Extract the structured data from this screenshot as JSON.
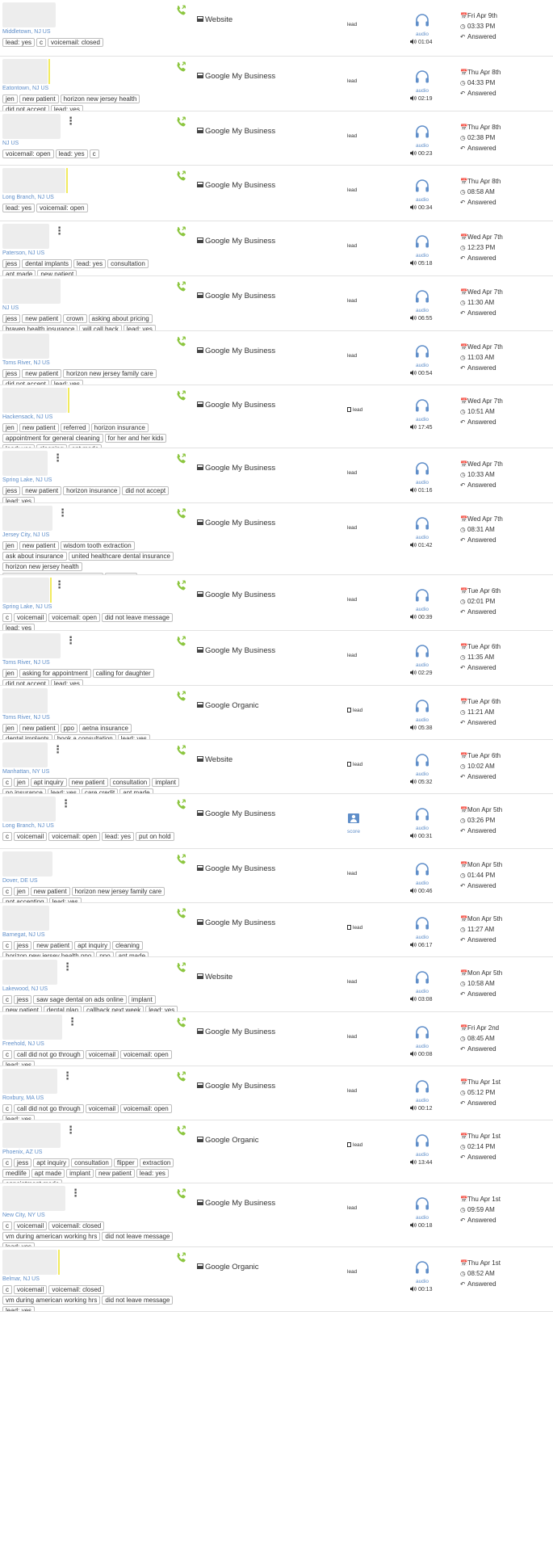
{
  "colors": {
    "accent": "#5f8ec9",
    "phone": "#8cc63f",
    "highlight": "#f1ea5e",
    "tag_border": "#bdbdbd"
  },
  "icons": {
    "phone": "phone-icon",
    "source": "source-icon",
    "headphones": "headphones-icon",
    "speaker": "speaker-icon",
    "calendar": "calendar-icon",
    "clock": "clock-icon",
    "answered": "answered-icon",
    "score": "user-score-icon",
    "kebab": "kebab-icon"
  },
  "calls": [
    {
      "location": "Middletown, NJ US",
      "tags": [
        "lead: yes",
        "c",
        "voicemail: closed"
      ],
      "source": "Website",
      "status": "lead",
      "audio_label": "audio",
      "duration": "01:04",
      "date": "Fri Apr 9th",
      "time": "03:33 PM",
      "result": "Answered",
      "bw": 66,
      "kebab": false,
      "yellow": false
    },
    {
      "location": "Eatontown, NJ US",
      "tags": [
        "jen",
        "new patient",
        "horizon new jersey health",
        "did not accept",
        "lead: yes"
      ],
      "source": "Google My Business",
      "status": "lead",
      "audio_label": "audio",
      "duration": "02:19",
      "date": "Thu Apr 8th",
      "time": "04:33 PM",
      "result": "Answered",
      "bw": 56,
      "kebab": false,
      "yellow": true
    },
    {
      "location": "NJ US",
      "tags": [
        "voicemail: open",
        "lead: yes",
        "c"
      ],
      "source": "Google My Business",
      "status": "lead",
      "audio_label": "audio",
      "duration": "00:23",
      "date": "Thu Apr 8th",
      "time": "02:38 PM",
      "result": "Answered",
      "bw": 72,
      "kebab": true,
      "yellow": false
    },
    {
      "location": "Long Branch, NJ US",
      "tags": [
        "lead: yes",
        "voicemail: open"
      ],
      "source": "Google My Business",
      "status": "lead",
      "audio_label": "audio",
      "duration": "00:34",
      "date": "Thu Apr 8th",
      "time": "08:58 AM",
      "result": "Answered",
      "bw": 78,
      "kebab": false,
      "yellow": true
    },
    {
      "location": "Paterson, NJ US",
      "tags": [
        "jess",
        "dental implants",
        "lead: yes",
        "consultation",
        "apt made",
        "new patient"
      ],
      "source": "Google My Business",
      "status": "lead",
      "audio_label": "audio",
      "duration": "05:18",
      "date": "Wed Apr 7th",
      "time": "12:23 PM",
      "result": "Answered",
      "bw": 58,
      "kebab": true,
      "yellow": false
    },
    {
      "location": "NJ US",
      "tags": [
        "jess",
        "new patient",
        "crown",
        "asking about pricing",
        "braven health insurance",
        "will call back",
        "lead: yes"
      ],
      "source": "Google My Business",
      "status": "lead",
      "audio_label": "audio",
      "duration": "06:55",
      "date": "Wed Apr 7th",
      "time": "11:30 AM",
      "result": "Answered",
      "bw": 72,
      "kebab": false,
      "yellow": false
    },
    {
      "location": "Toms River, NJ US",
      "tags": [
        "jess",
        "new patient",
        "horizon new jersey family care",
        "did not accept",
        "lead: yes"
      ],
      "source": "Google My Business",
      "status": "lead",
      "audio_label": "audio",
      "duration": "00:54",
      "date": "Wed Apr 7th",
      "time": "11:03 AM",
      "result": "Answered",
      "bw": 58,
      "kebab": false,
      "yellow": false
    },
    {
      "location": "Hackensack, NJ US",
      "tags": [
        "jen",
        "new patient",
        "referred",
        "horizon insurance",
        "appointment for general cleaning",
        "for her and her kids",
        "lead: yes",
        "cleaning",
        "apt made"
      ],
      "source": "Google My Business",
      "status": "lead",
      "doc": true,
      "audio_label": "audio",
      "duration": "17:45",
      "date": "Wed Apr 7th",
      "time": "10:51 AM",
      "result": "Answered",
      "bw": 80,
      "kebab": false,
      "yellow": true
    },
    {
      "location": "Spring Lake, NJ US",
      "tags": [
        "jess",
        "new patient",
        "horizon insurance",
        "did not accept",
        "lead: yes"
      ],
      "source": "Google My Business",
      "status": "lead",
      "audio_label": "audio",
      "duration": "01:16",
      "date": "Wed Apr 7th",
      "time": "10:33 AM",
      "result": "Answered",
      "bw": 56,
      "kebab": true,
      "yellow": false
    },
    {
      "location": "Jersey City, NJ US",
      "tags": [
        "jen",
        "new patient",
        "wisdom tooth extraction",
        "ask about insurance",
        "united healthcare dental insurance",
        "horizon new jersey health",
        "being referred to an oral surgeon",
        "lead: yes"
      ],
      "source": "Google My Business",
      "status": "lead",
      "audio_label": "audio",
      "duration": "01:42",
      "date": "Wed Apr 7th",
      "time": "08:31 AM",
      "result": "Answered",
      "bw": 62,
      "kebab": true,
      "yellow": false
    },
    {
      "location": "Spring Lake, NJ US",
      "tags": [
        "c",
        "voicemail",
        "voicemail: open",
        "did not leave message",
        "lead: yes"
      ],
      "source": "Google My Business",
      "status": "lead",
      "audio_label": "audio",
      "duration": "00:39",
      "date": "Tue Apr 6th",
      "time": "02:01 PM",
      "result": "Answered",
      "bw": 58,
      "kebab": true,
      "yellow": true
    },
    {
      "location": "Toms River, NJ US",
      "tags": [
        "jen",
        "asking for appointment",
        "calling for daughter",
        "did not accept",
        "lead: yes"
      ],
      "source": "Google My Business",
      "status": "lead",
      "audio_label": "audio",
      "duration": "02:29",
      "date": "Tue Apr 6th",
      "time": "11:35 AM",
      "result": "Answered",
      "bw": 72,
      "kebab": true,
      "yellow": false
    },
    {
      "location": "Toms River, NJ US",
      "tags": [
        "jen",
        "new patient",
        "ppo",
        "aetna insurance",
        "dental implants",
        "book a consultation",
        "lead: yes"
      ],
      "source": "Google Organic",
      "status": "lead",
      "doc": true,
      "audio_label": "audio",
      "duration": "05:38",
      "date": "Tue Apr 6th",
      "time": "11:21 AM",
      "result": "Answered",
      "bw": 56,
      "kebab": false,
      "yellow": false
    },
    {
      "location": "Manhattan, NY US",
      "tags": [
        "c",
        "jen",
        "apt inquiry",
        "new patient",
        "consultation",
        "implant",
        "no insurance",
        "lead: yes",
        "care credit",
        "apt made"
      ],
      "source": "Website",
      "status": "lead",
      "doc": true,
      "audio_label": "audio",
      "duration": "05:32",
      "date": "Tue Apr 6th",
      "time": "10:02 AM",
      "result": "Answered",
      "bw": 56,
      "kebab": true,
      "yellow": false
    },
    {
      "location": "Long Branch, NJ US",
      "tags": [
        "c",
        "voicemail",
        "voicemail: open",
        "lead: yes",
        "put on hold"
      ],
      "source": "Google My Business",
      "status": "score",
      "score": true,
      "audio_label": "audio",
      "duration": "00:31",
      "date": "Mon Apr 5th",
      "time": "03:26 PM",
      "result": "Answered",
      "bw": 66,
      "kebab": true,
      "yellow": false
    },
    {
      "location": "Dover, DE US",
      "tags": [
        "c",
        "jen",
        "new patient",
        "horizon new jersey family care",
        "not accepting",
        "lead: yes"
      ],
      "source": "Google My Business",
      "status": "lead",
      "audio_label": "audio",
      "duration": "00:46",
      "date": "Mon Apr 5th",
      "time": "01:44 PM",
      "result": "Answered",
      "bw": 62,
      "kebab": false,
      "yellow": false
    },
    {
      "location": "Barnegat, NJ US",
      "tags": [
        "c",
        "jess",
        "new patient",
        "apt inquiry",
        "cleaning",
        "horizon new jersey health ppo",
        "ppo",
        "apt made",
        "lead: yes"
      ],
      "source": "Google My Business",
      "status": "lead",
      "doc": true,
      "audio_label": "audio",
      "duration": "06:17",
      "date": "Mon Apr 5th",
      "time": "11:27 AM",
      "result": "Answered",
      "bw": 58,
      "kebab": false,
      "yellow": false
    },
    {
      "location": "Lakewood, NJ US",
      "tags": [
        "c",
        "jess",
        "saw sage dental on ads online",
        "implant",
        "new patient",
        "dental plan",
        "callback next week",
        "lead: yes"
      ],
      "source": "Website",
      "status": "lead",
      "audio_label": "audio",
      "duration": "03:08",
      "date": "Mon Apr 5th",
      "time": "10:58 AM",
      "result": "Answered",
      "bw": 68,
      "kebab": true,
      "yellow": false
    },
    {
      "location": "Freehold, NJ US",
      "tags": [
        "c",
        "call did not go through",
        "voicemail",
        "voicemail: open",
        "lead: yes"
      ],
      "source": "Google My Business",
      "status": "lead",
      "audio_label": "audio",
      "duration": "00:08",
      "date": "Fri Apr 2nd",
      "time": "08:45 AM",
      "result": "Answered",
      "bw": 74,
      "kebab": true,
      "yellow": false
    },
    {
      "location": "Roxbury, MA US",
      "tags": [
        "c",
        "call did not go through",
        "voicemail",
        "voicemail: open",
        "lead: yes"
      ],
      "source": "Google My Business",
      "status": "lead",
      "audio_label": "audio",
      "duration": "00:12",
      "date": "Thu Apr 1st",
      "time": "05:12 PM",
      "result": "Answered",
      "bw": 68,
      "kebab": true,
      "yellow": false
    },
    {
      "location": "Phoenix, AZ US",
      "tags": [
        "c",
        "jess",
        "apt inquiry",
        "consultation",
        "flipper",
        "extraction",
        "medlife",
        "apt made",
        "implant",
        "new patient",
        "lead: yes",
        "appointment made"
      ],
      "source": "Google Organic",
      "status": "lead",
      "doc": true,
      "audio_label": "audio",
      "duration": "13:44",
      "date": "Thu Apr 1st",
      "time": "02:14 PM",
      "result": "Answered",
      "bw": 72,
      "kebab": true,
      "yellow": false
    },
    {
      "location": "New City, NY US",
      "tags": [
        "c",
        "voicemail",
        "voicemail: closed",
        "vm during american working hrs",
        "did not leave message",
        "lead: yes"
      ],
      "source": "Google My Business",
      "status": "lead",
      "audio_label": "audio",
      "duration": "00:18",
      "date": "Thu Apr 1st",
      "time": "09:59 AM",
      "result": "Answered",
      "bw": 78,
      "kebab": true,
      "yellow": false
    },
    {
      "location": "Belmar, NJ US",
      "tags": [
        "c",
        "voicemail",
        "voicemail: closed",
        "vm during american working hrs",
        "did not leave message",
        "lead: yes"
      ],
      "source": "Google Organic",
      "status": "lead",
      "audio_label": "audio",
      "duration": "00:13",
      "date": "Thu Apr 1st",
      "time": "08:52 AM",
      "result": "Answered",
      "bw": 68,
      "kebab": false,
      "yellow": true
    }
  ]
}
